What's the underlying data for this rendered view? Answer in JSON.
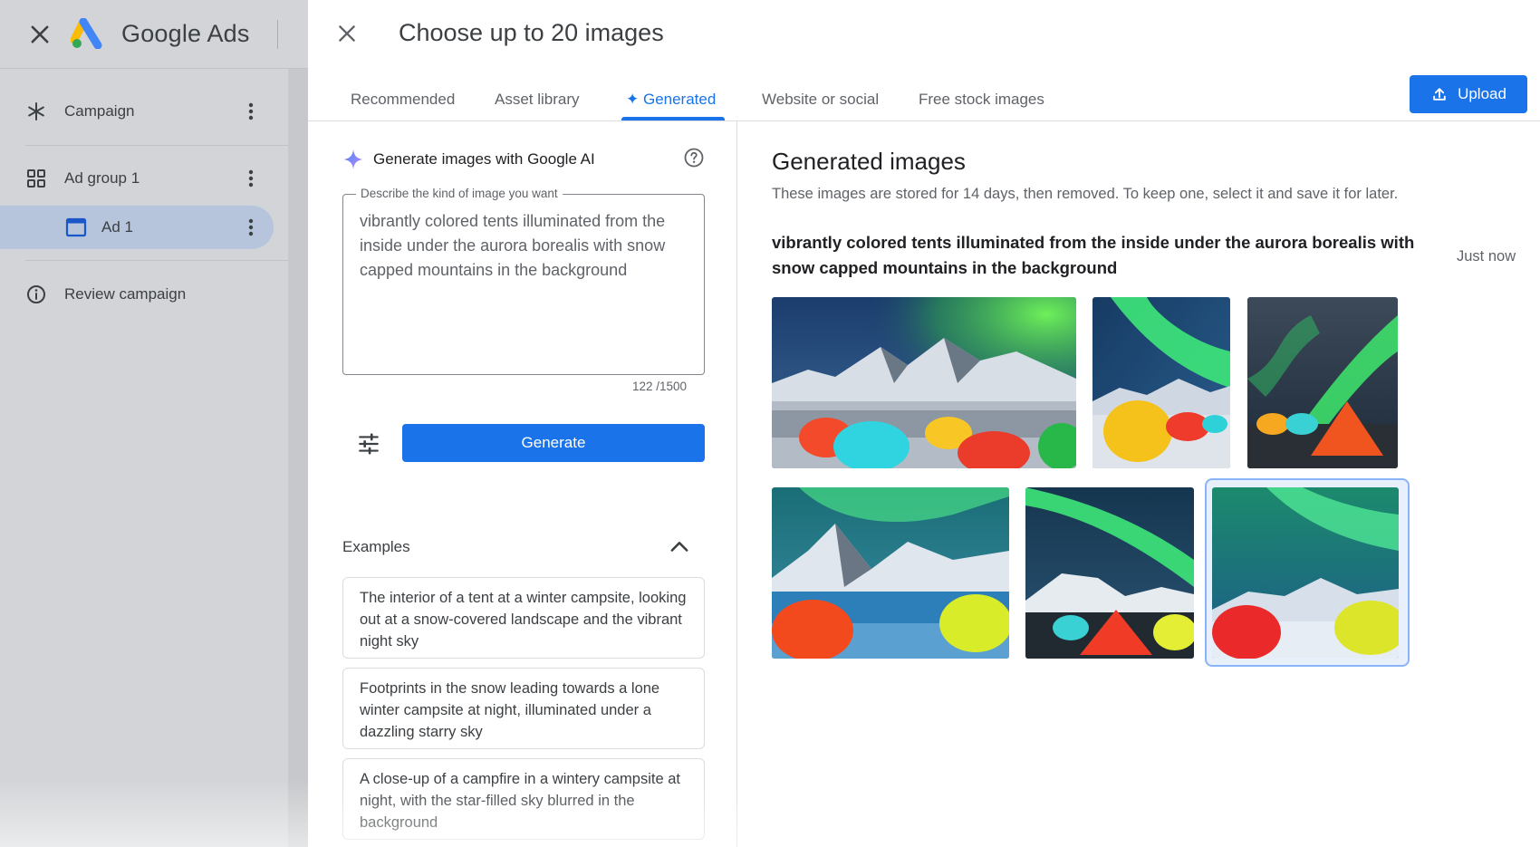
{
  "app": {
    "name": "Google Ads"
  },
  "nav": {
    "items": [
      {
        "label": "Campaign",
        "icon": "asterisk-icon"
      },
      {
        "label": "Ad group 1",
        "icon": "grid-icon"
      },
      {
        "label": "Ad 1",
        "icon": "ad-window-icon",
        "selected": true
      },
      {
        "label": "Review campaign",
        "icon": "info-icon"
      }
    ]
  },
  "dialog": {
    "title": "Choose up to 20 images",
    "tabs": [
      {
        "label": "Recommended"
      },
      {
        "label": "Asset library"
      },
      {
        "label": "✦ Generated",
        "active": true
      },
      {
        "label": "Website or social"
      },
      {
        "label": "Free stock images"
      }
    ],
    "upload_label": "Upload"
  },
  "generator": {
    "heading": "Generate images with Google AI",
    "prompt_label": "Describe the kind of image you want",
    "prompt_value": "vibrantly colored tents illuminated from the inside under the aurora borealis with snow capped mountains in the background",
    "counter": "122 /1500",
    "generate_label": "Generate",
    "examples_label": "Examples",
    "examples": [
      "The interior of a tent at a winter campsite, looking out at a snow-covered landscape and the vibrant night sky",
      "Footprints in the snow leading towards a lone winter campsite at night, illuminated under a dazzling starry sky",
      "A close-up of a campfire in a wintery campsite at night, with the star-filled sky blurred in the background"
    ]
  },
  "results": {
    "title": "Generated images",
    "subtitle": "These images are stored for 14 days, then removed. To keep one, select it and save it for later.",
    "prompt": "vibrantly colored tents illuminated from the inside under the aurora borealis with snow capped mountains in the background",
    "time": "Just now"
  },
  "colors": {
    "accent": "#1a73e8",
    "selected_nav": "#b6c4dc",
    "aurora_green": "#2ee07a"
  }
}
